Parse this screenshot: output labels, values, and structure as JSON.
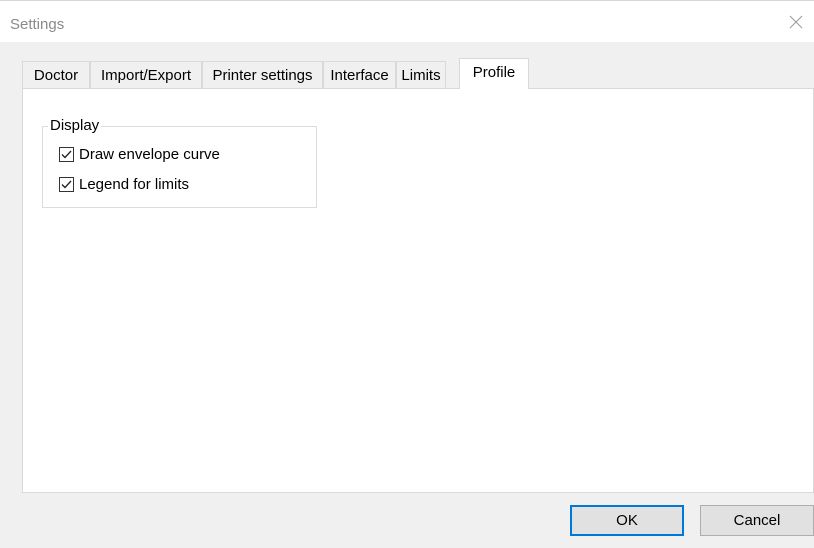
{
  "window": {
    "title": "Settings"
  },
  "tabs": [
    {
      "label": "Doctor"
    },
    {
      "label": "Import/Export"
    },
    {
      "label": "Printer settings"
    },
    {
      "label": "Interface"
    },
    {
      "label": "Limits"
    },
    {
      "label": "Profile",
      "active": true
    }
  ],
  "display_group": {
    "label": "Display",
    "options": [
      {
        "label": "Draw envelope curve",
        "checked": true
      },
      {
        "label": "Legend for limits",
        "checked": true
      }
    ]
  },
  "buttons": {
    "ok": "OK",
    "cancel": "Cancel"
  },
  "colors": {
    "accent": "#0078d7",
    "title_text": "#8a8a8a"
  },
  "icons": {
    "close": "close-icon",
    "check": "checkmark-icon"
  }
}
